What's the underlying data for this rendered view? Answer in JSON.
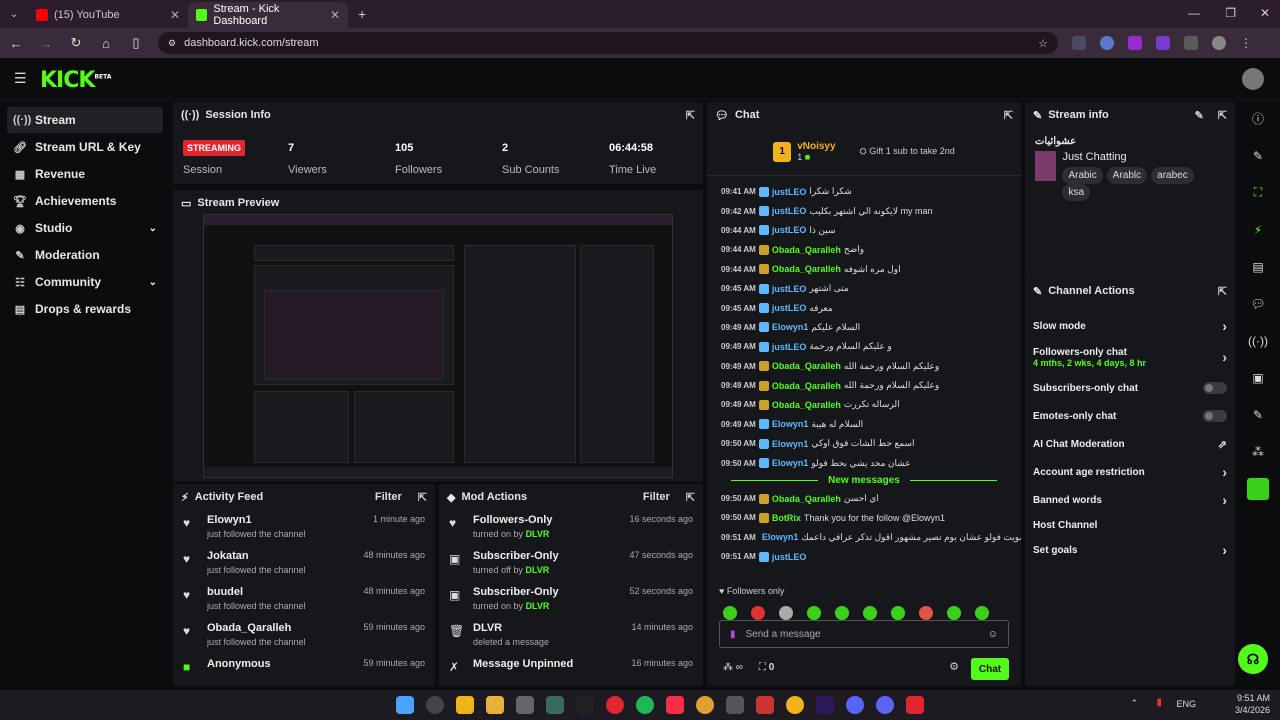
{
  "browser": {
    "tabs": [
      {
        "title": "(15) YouTube",
        "color": "#ff0000"
      },
      {
        "title": "Stream - Kick Dashboard",
        "color": "#53fc18"
      }
    ],
    "url": "dashboard.kick.com/stream"
  },
  "app": {
    "logo": "KICK",
    "logo_badge": "BETA"
  },
  "sidebar": {
    "items": [
      {
        "label": "Stream",
        "icon": "stream-icon"
      },
      {
        "label": "Stream URL & Key",
        "icon": "link-icon"
      },
      {
        "label": "Revenue",
        "icon": "revenue-icon"
      },
      {
        "label": "Achievements",
        "icon": "trophy-icon"
      },
      {
        "label": "Studio",
        "icon": "studio-icon"
      },
      {
        "label": "Moderation",
        "icon": "wrench-icon"
      },
      {
        "label": "Community",
        "icon": "community-icon"
      },
      {
        "label": "Drops & rewards",
        "icon": "drops-icon"
      }
    ]
  },
  "session": {
    "title": "Session Info",
    "status": "STREAMING",
    "status_label": "Session",
    "viewers": "7",
    "viewers_label": "Viewers",
    "followers": "105",
    "followers_label": "Followers",
    "subs": "2",
    "subs_label": "Sub Counts",
    "time": "06:44:58",
    "time_label": "Time Live"
  },
  "preview": {
    "title": "Stream Preview"
  },
  "activity": {
    "title": "Activity Feed",
    "filter": "Filter",
    "items": [
      {
        "name": "Elowyn1",
        "desc": "just followed the channel",
        "time": "1 minute ago"
      },
      {
        "name": "Jokatan",
        "desc": "just followed the channel",
        "time": "48 minutes ago"
      },
      {
        "name": "buudel",
        "desc": "just followed the channel",
        "time": "48 minutes ago"
      },
      {
        "name": "Obada_Qaralleh",
        "desc": "just followed the channel",
        "time": "59 minutes ago"
      },
      {
        "name": "Anonymous",
        "desc": "",
        "time": "59 minutes ago"
      }
    ]
  },
  "mod": {
    "title": "Mod Actions",
    "filter": "Filter",
    "items": [
      {
        "name": "Followers-Only",
        "desc": "turned on by",
        "who": "DLVR",
        "time": "16 seconds ago"
      },
      {
        "name": "Subscriber-Only",
        "desc": "turned off by",
        "who": "DLVR",
        "time": "47 seconds ago"
      },
      {
        "name": "Subscriber-Only",
        "desc": "turned on by",
        "who": "DLVR",
        "time": "52 seconds ago"
      },
      {
        "name": "DLVR",
        "desc": "deleted a message",
        "who": "",
        "time": "14 minutes ago"
      },
      {
        "name": "Message Unpinned",
        "desc": "",
        "who": "",
        "time": "16 minutes ago"
      }
    ]
  },
  "chat": {
    "title": "Chat",
    "top_gifter": "vNoisyy",
    "top_gifter_count": "1",
    "top_rank": "1",
    "gift_text": "Gift 1 sub to take 2nd",
    "messages": [
      {
        "time": "09:41 AM",
        "user": "justLEO",
        "color": "#5fb8ff",
        "msg": "شكرا شكرا"
      },
      {
        "time": "09:42 AM",
        "user": "justLEO",
        "color": "#5fb8ff",
        "msg": "لايكونه الي اشتهر بكليب my man"
      },
      {
        "time": "09:44 AM",
        "user": "justLEO",
        "color": "#5fb8ff",
        "msg": "سين ذا"
      },
      {
        "time": "09:44 AM",
        "user": "Obada_Qaralleh",
        "color": "#53fc18",
        "msg": "واضح"
      },
      {
        "time": "09:44 AM",
        "user": "Obada_Qaralleh",
        "color": "#53fc18",
        "msg": "اول مره اشوفه"
      },
      {
        "time": "09:45 AM",
        "user": "justLEO",
        "color": "#5fb8ff",
        "msg": "متى اشتهر"
      },
      {
        "time": "09:45 AM",
        "user": "justLEO",
        "color": "#5fb8ff",
        "msg": "معرفه"
      },
      {
        "time": "09:49 AM",
        "user": "Elowyn1",
        "color": "#5fb8ff",
        "msg": "السلام عليكم"
      },
      {
        "time": "09:49 AM",
        "user": "justLEO",
        "color": "#5fb8ff",
        "msg": "و عليكم السلام ورحمة"
      },
      {
        "time": "09:49 AM",
        "user": "Obada_Qaralleh",
        "color": "#53fc18",
        "msg": "وعليكم السلام ورحمة الله"
      },
      {
        "time": "09:49 AM",
        "user": "Obada_Qaralleh",
        "color": "#53fc18",
        "msg": "وعليكم السلام ورحمة الله"
      },
      {
        "time": "09:49 AM",
        "user": "Obada_Qaralleh",
        "color": "#53fc18",
        "msg": "الرساله تكررت"
      },
      {
        "time": "09:49 AM",
        "user": "Elowyn1",
        "color": "#5fb8ff",
        "msg": "السلام له هيبة"
      },
      {
        "time": "09:50 AM",
        "user": "Elowyn1",
        "color": "#5fb8ff",
        "msg": "اسمع حط الشات فوق اوكي"
      },
      {
        "time": "09:50 AM",
        "user": "Elowyn1",
        "color": "#5fb8ff",
        "msg": "عشان محد يشي بحط فولو"
      }
    ],
    "new_messages_label": "New messages",
    "new_messages": [
      {
        "time": "09:50 AM",
        "user": "Obada_Qaralleh",
        "color": "#53fc18",
        "msg": "اي احسن"
      },
      {
        "time": "09:50 AM",
        "user": "BotRix",
        "color": "#53fc18",
        "msg": "Thank you for the follow @Elowyn1"
      },
      {
        "time": "09:51 AM",
        "user": "Elowyn1",
        "color": "#5fb8ff",
        "msg": "سويت فولو عشان يوم تصير مشهور اقول تذكر عرافي داعمك"
      },
      {
        "time": "09:51 AM",
        "user": "justLEO",
        "color": "#5fb8ff",
        "msg": ""
      }
    ],
    "followers_only": "Followers only",
    "placeholder": "Send a message",
    "send": "Chat",
    "points": "0"
  },
  "stream_info": {
    "title": "Stream info",
    "stream_title": "عشوائيات",
    "category": "Just Chatting",
    "tags": [
      "Arabic",
      "Arablc",
      "arabec",
      "ksa"
    ]
  },
  "channel_actions": {
    "title": "Channel Actions",
    "items": [
      {
        "label": "Slow mode",
        "type": "chev"
      },
      {
        "label": "Followers-only chat",
        "sub": "4 mths, 2 wks, 4 days, 8 hr",
        "type": "chev"
      },
      {
        "label": "Subscribers-only chat",
        "type": "toggle"
      },
      {
        "label": "Emotes-only chat",
        "type": "toggle"
      },
      {
        "label": "AI Chat Moderation",
        "type": "ext"
      },
      {
        "label": "Account age restriction",
        "type": "chev"
      },
      {
        "label": "Banned words",
        "type": "chev"
      },
      {
        "label": "Host Channel",
        "type": "none"
      },
      {
        "label": "Set goals",
        "type": "chev"
      }
    ]
  },
  "taskbar": {
    "lang": "ENG",
    "time": "9:51 AM",
    "date": "3/4/2026"
  }
}
